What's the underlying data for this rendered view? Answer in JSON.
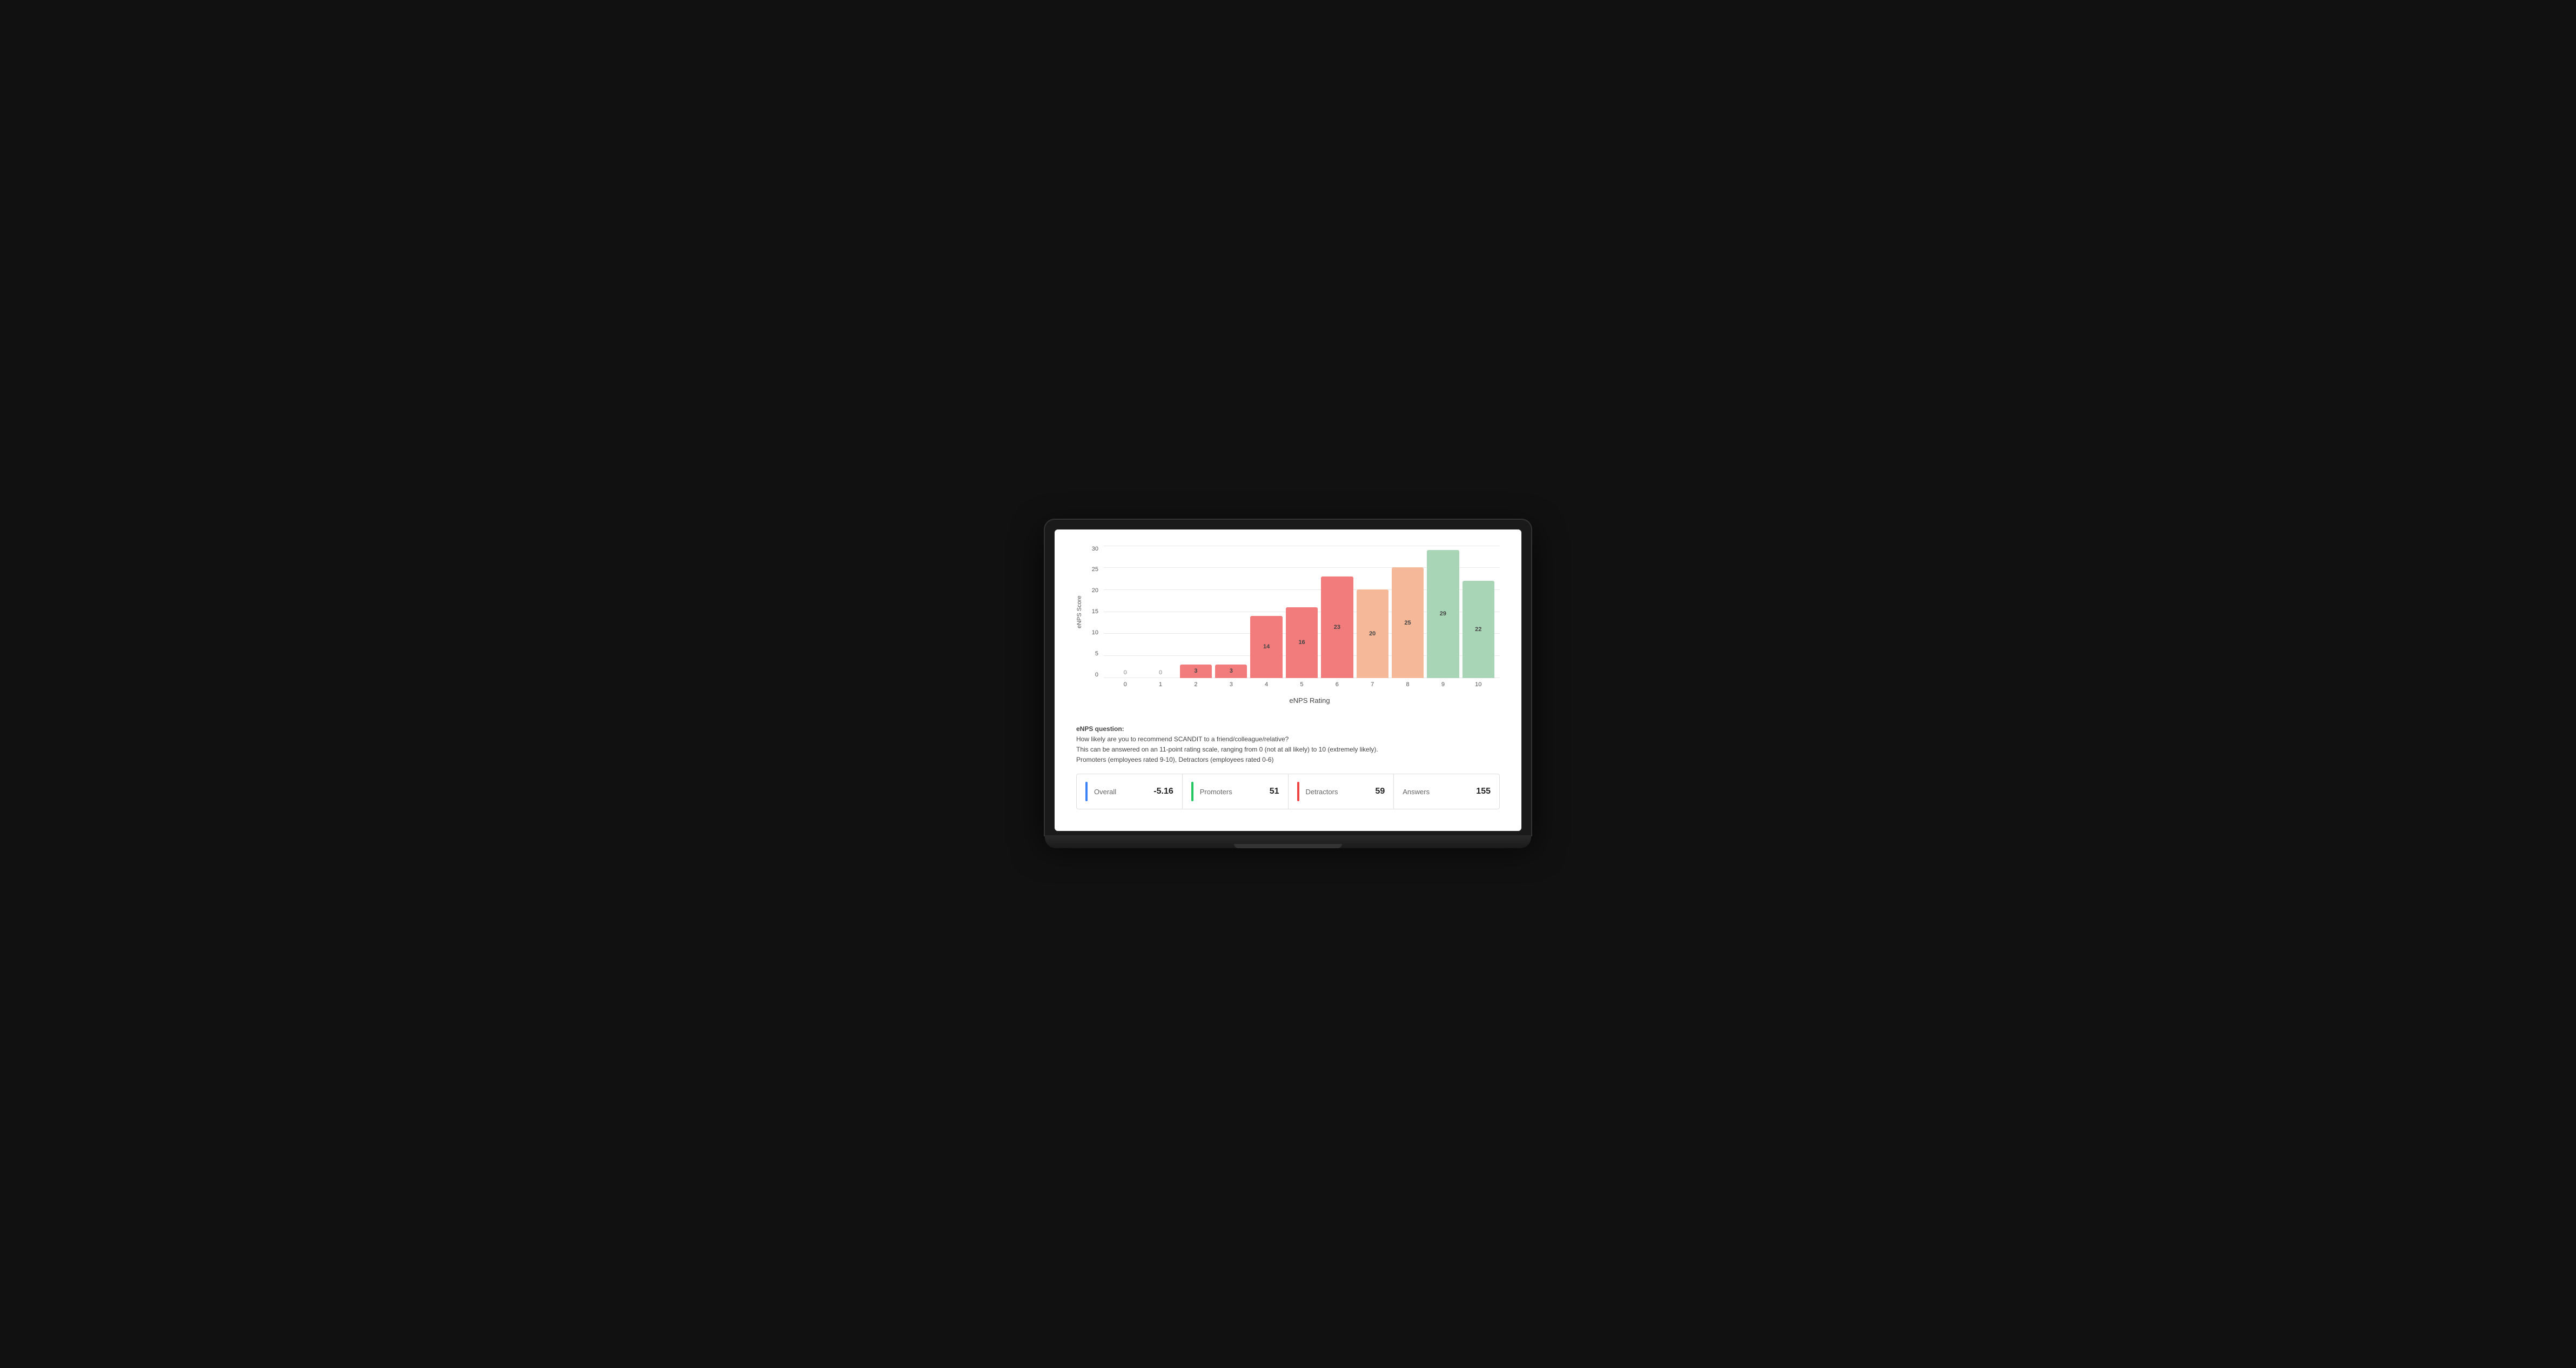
{
  "chart": {
    "y_axis_label": "eNPS Score",
    "x_axis_label": "eNPS Rating",
    "y_ticks": [
      "0",
      "5",
      "10",
      "15",
      "20",
      "25",
      "30"
    ],
    "bars": [
      {
        "rating": "0",
        "value": 0,
        "color": "none",
        "label": "0"
      },
      {
        "rating": "1",
        "value": 0,
        "color": "none",
        "label": "0"
      },
      {
        "rating": "2",
        "value": 3,
        "color": "bar-red-dark",
        "label": "3"
      },
      {
        "rating": "3",
        "value": 3,
        "color": "bar-red-dark",
        "label": "3"
      },
      {
        "rating": "4",
        "value": 14,
        "color": "bar-red-dark",
        "label": "14"
      },
      {
        "rating": "5",
        "value": 16,
        "color": "bar-red-dark",
        "label": "16"
      },
      {
        "rating": "6",
        "value": 23,
        "color": "bar-red-dark",
        "label": "23"
      },
      {
        "rating": "7",
        "value": 20,
        "color": "bar-peach",
        "label": "20"
      },
      {
        "rating": "8",
        "value": 25,
        "color": "bar-peach",
        "label": "25"
      },
      {
        "rating": "9",
        "value": 29,
        "color": "bar-green-light",
        "label": "29"
      },
      {
        "rating": "10",
        "value": 22,
        "color": "bar-green-light",
        "label": "22"
      }
    ],
    "max_value": 30
  },
  "note": {
    "question_label": "eNPS question:",
    "question_text": "How likely are you to recommend SCANDIT to a friend/colleague/relative?",
    "scale_text": "This can be answered on an 11-point rating scale, ranging from 0 (not at all likely) to 10 (extremely likely).",
    "definition_text": "Promoters (employees rated 9-10), Detractors (employees rated 0-6)"
  },
  "stats": [
    {
      "label": "Overall",
      "value": "-5.16",
      "accent": "accent-blue"
    },
    {
      "label": "Promoters",
      "value": "51",
      "accent": "accent-green"
    },
    {
      "label": "Detractors",
      "value": "59",
      "accent": "accent-red"
    },
    {
      "label": "Answers",
      "value": "155",
      "accent": ""
    }
  ]
}
